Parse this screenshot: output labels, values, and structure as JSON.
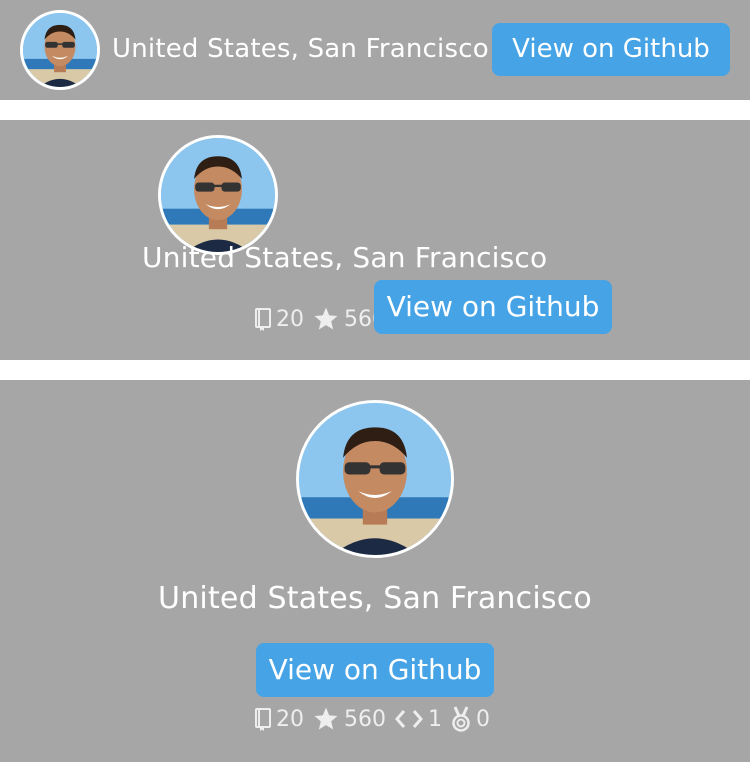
{
  "profile": {
    "location": "United States, San Francisco",
    "github_button_label": "View on Github",
    "stats": [
      {
        "icon": "repo-icon",
        "value": "20"
      },
      {
        "icon": "star-icon",
        "value": "560"
      },
      {
        "icon": "code-icon",
        "value": "1"
      },
      {
        "icon": "medal-icon",
        "value": "0"
      }
    ]
  },
  "colors": {
    "panel_background": "#a6a6a6",
    "button_background": "#45a3e6",
    "text": "#ffffff",
    "stats_text": "#eeeeee"
  }
}
